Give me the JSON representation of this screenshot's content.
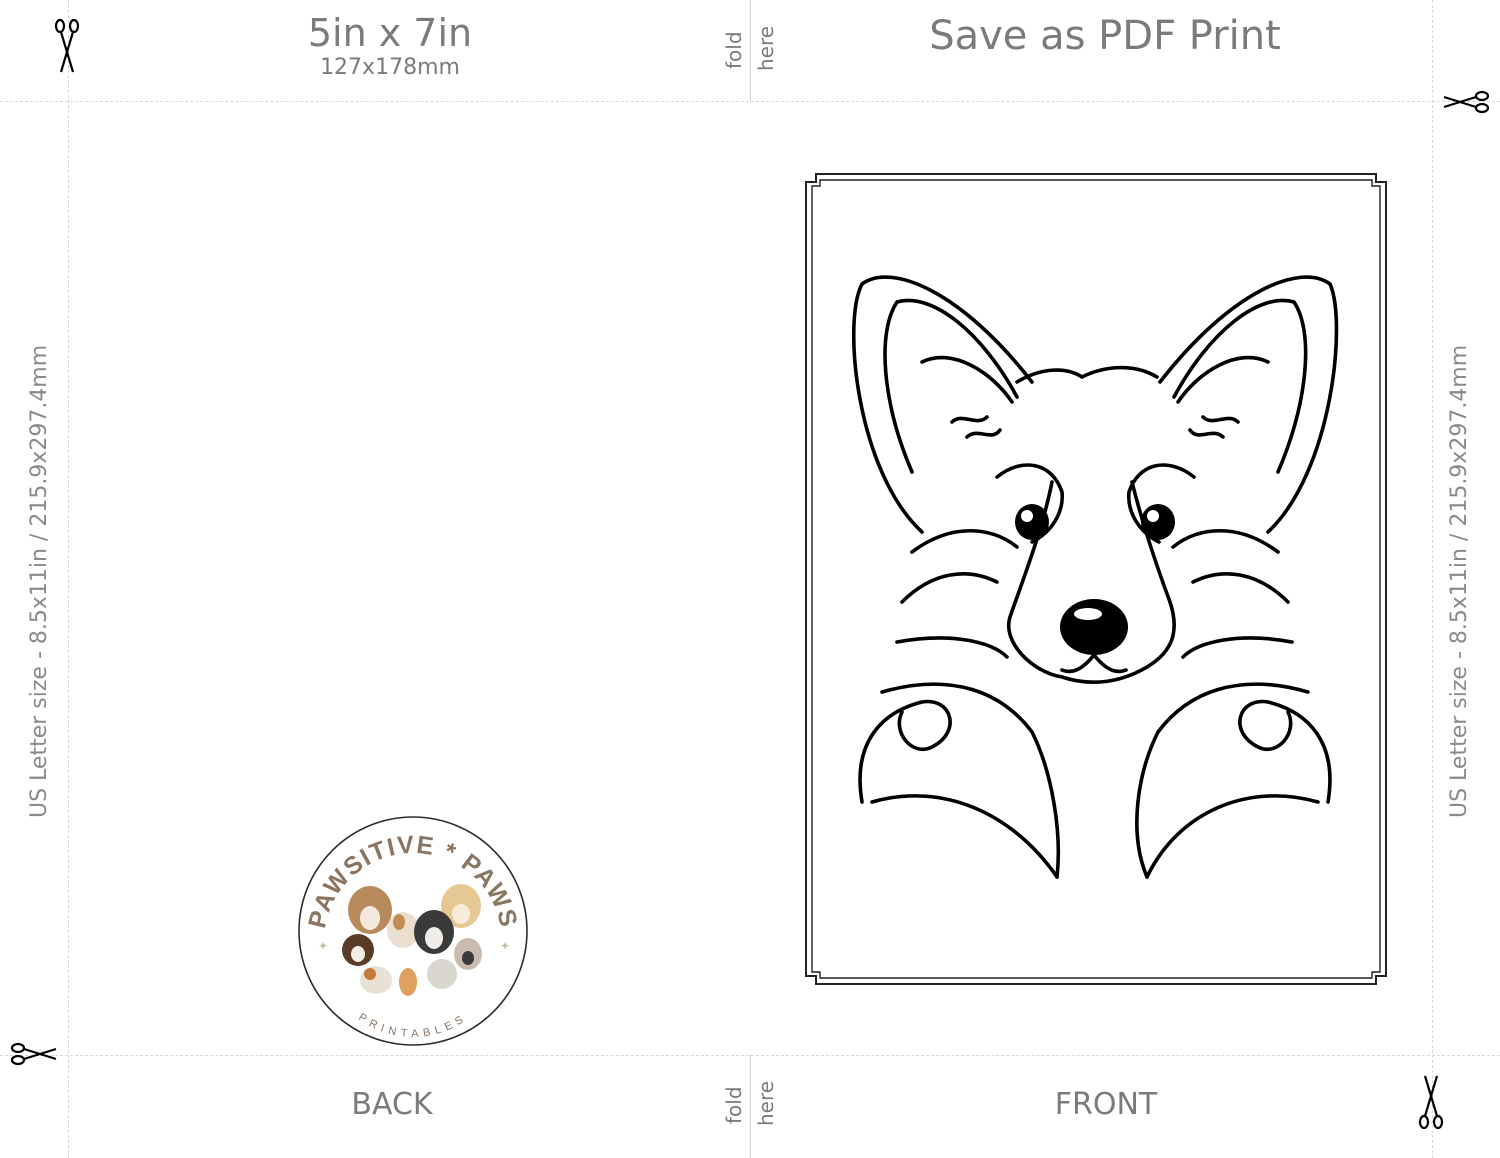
{
  "header": {
    "size_title": "5in x 7in",
    "size_sub": "127x178mm",
    "save_label": "Save as PDF Print"
  },
  "fold": {
    "word1": "fold",
    "word2": "here"
  },
  "sides": {
    "left_label": "US Letter size - 8.5x11in / 215.9x297.4mm",
    "right_label": "US Letter size - 8.5x11in / 215.9x297.4mm"
  },
  "panels": {
    "back": "BACK",
    "front": "FRONT"
  },
  "logo": {
    "brand_text": "PAWSITIVE * PAWS",
    "sub_text": "PRINTABLES"
  },
  "colors": {
    "label_gray": "#7b7b7b",
    "guide_gray": "#d9d9d9",
    "logo_brown": "#8a7563",
    "line_art": "#000000"
  },
  "icons": [
    "scissors-icon",
    "corgi-line-art",
    "pawsitive-paws-logo"
  ]
}
